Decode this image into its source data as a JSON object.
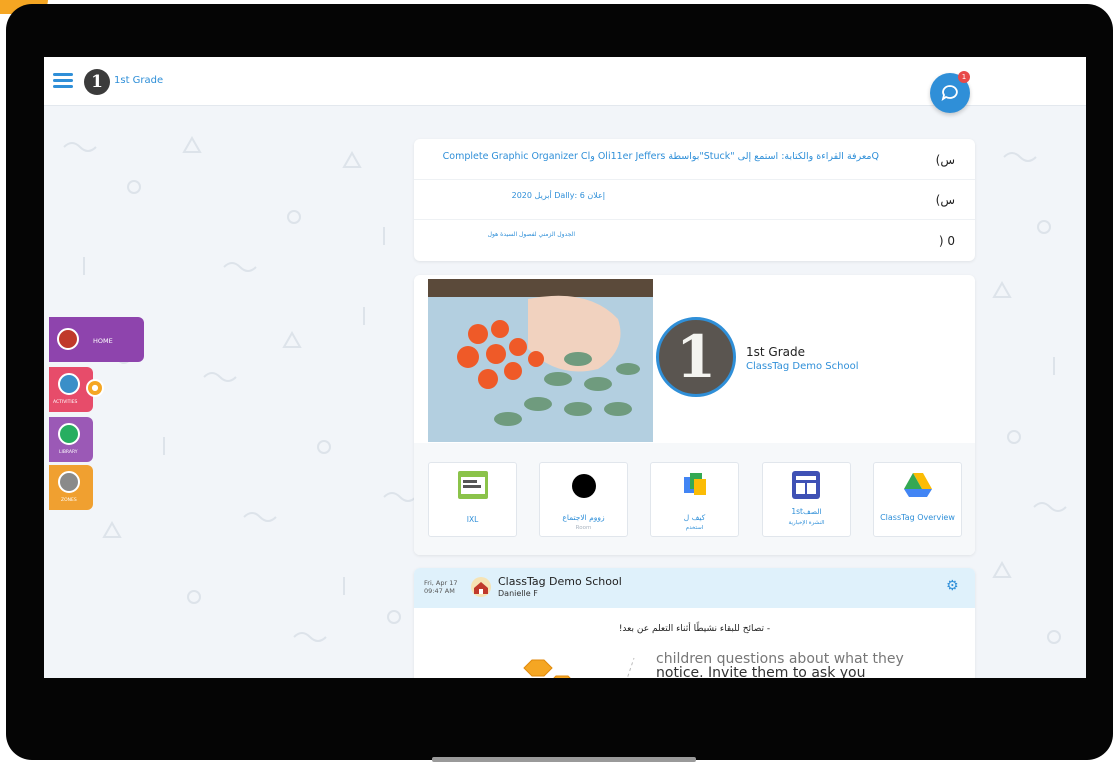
{
  "header": {
    "class_badge": "1",
    "class_name": "1st Grade",
    "chat_badge_count": "1"
  },
  "sidebar": {
    "items": [
      {
        "label": "HOME",
        "icon": "home-icon",
        "color": "#8e44ad"
      },
      {
        "label": "ACTIVITIES",
        "icon": "globe-icon",
        "color": "#e74c6a"
      },
      {
        "label": "LIBRARY",
        "icon": "globe-icon",
        "color": "#9b59b6"
      },
      {
        "label": "ZONES",
        "icon": "globe-icon",
        "color": "#f0a030"
      }
    ]
  },
  "announcements": [
    {
      "text": "Qمعرفة القراءة والكتابة: استمع إلى \"Stuck\"بواسطة Oli11er Jeffers وComplete Graphic Organizer Cl",
      "mark": "(س"
    },
    {
      "text": "إعلان 6 :Dally أبريل 2020",
      "mark": "(س"
    },
    {
      "text": "الجدول الزمني لفصول السيدة هول",
      "mark": ") 0"
    }
  ],
  "class_card": {
    "badge": "1",
    "title": "1st Grade",
    "school": "ClassTag Demo School"
  },
  "apps": [
    {
      "label": "IXL",
      "sub": "",
      "icon": "ixl-icon"
    },
    {
      "label": "زووم الاجتماع",
      "sub": "Room",
      "icon": "zoom-icon"
    },
    {
      "label": "كيف ل",
      "sub": "استخدم",
      "icon": "docs-icon"
    },
    {
      "label": "1stالصف",
      "sub": "النشرة الإخبارية",
      "icon": "newsletter-icon"
    },
    {
      "label": "ClassTag Overview",
      "sub": "",
      "icon": "drive-icon"
    }
  ],
  "post": {
    "date_line1": "Fri, Apr 17",
    "date_line2": "09:47 AM",
    "school": "ClassTag Demo School",
    "author": "Danielle F",
    "title": "- تصائح للبقاء نشيطًا أثناء التعلم عن بعد!",
    "image_text_line1": "children questions about what they",
    "image_text_line2": "notice.  Invite them to ask you"
  },
  "colors": {
    "accent": "#2f8fd8",
    "home_tab": "#8e44ad",
    "activities_tab": "#e74c6a",
    "library_tab": "#9b59b6",
    "zones_tab": "#f0a030"
  }
}
